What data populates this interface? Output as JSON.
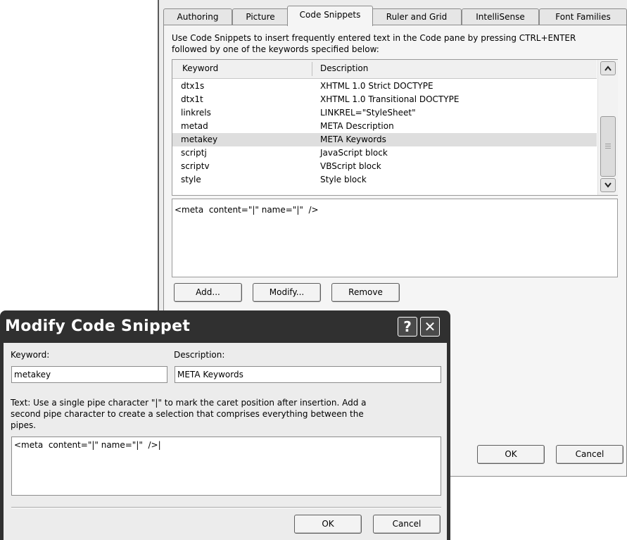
{
  "options": {
    "tabs": [
      "Authoring",
      "Picture",
      "Code Snippets",
      "Ruler and Grid",
      "IntelliSense",
      "Font Families"
    ],
    "active_tab": "Code Snippets",
    "intro_line1": "Use Code Snippets to insert frequently entered text in the Code pane by pressing CTRL+ENTER",
    "intro_line2": "followed by one of the keywords specified below:",
    "columns": {
      "keyword": "Keyword",
      "description": "Description"
    },
    "rows": [
      {
        "keyword": "dtx1s",
        "description": "XHTML 1.0 Strict DOCTYPE"
      },
      {
        "keyword": "dtx1t",
        "description": "XHTML 1.0 Transitional DOCTYPE"
      },
      {
        "keyword": "linkrels",
        "description": "LINKREL=\"StyleSheet\""
      },
      {
        "keyword": "metad",
        "description": "META Description"
      },
      {
        "keyword": "metakey",
        "description": "META Keywords"
      },
      {
        "keyword": "scriptj",
        "description": "JavaScript block"
      },
      {
        "keyword": "scriptv",
        "description": "VBScript block"
      },
      {
        "keyword": "style",
        "description": "Style block"
      }
    ],
    "selected_keyword": "metakey",
    "preview_text": "<meta  content=\"|\" name=\"|\"  />",
    "add_label": "Add...",
    "modify_label": "Modify...",
    "remove_label": "Remove",
    "ok_label": "OK",
    "cancel_label": "Cancel"
  },
  "dialog": {
    "title": "Modify Code Snippet",
    "help_glyph": "?",
    "close_glyph": "✕",
    "keyword_label": "Keyword:",
    "keyword_value": "metakey",
    "description_label": "Description:",
    "description_value": "META Keywords",
    "text_label_line1": "Text: Use a single pipe character \"|\" to mark the caret position after insertion. Add a",
    "text_label_line2": "second pipe character to create a selection that comprises everything between the",
    "text_label_line3": "pipes.",
    "text_value": "<meta  content=\"|\" name=\"|\"  />|",
    "ok_label": "OK",
    "cancel_label": "Cancel"
  },
  "icons": {
    "scroll_up": "chevron-up-icon",
    "scroll_down": "chevron-down-icon"
  }
}
